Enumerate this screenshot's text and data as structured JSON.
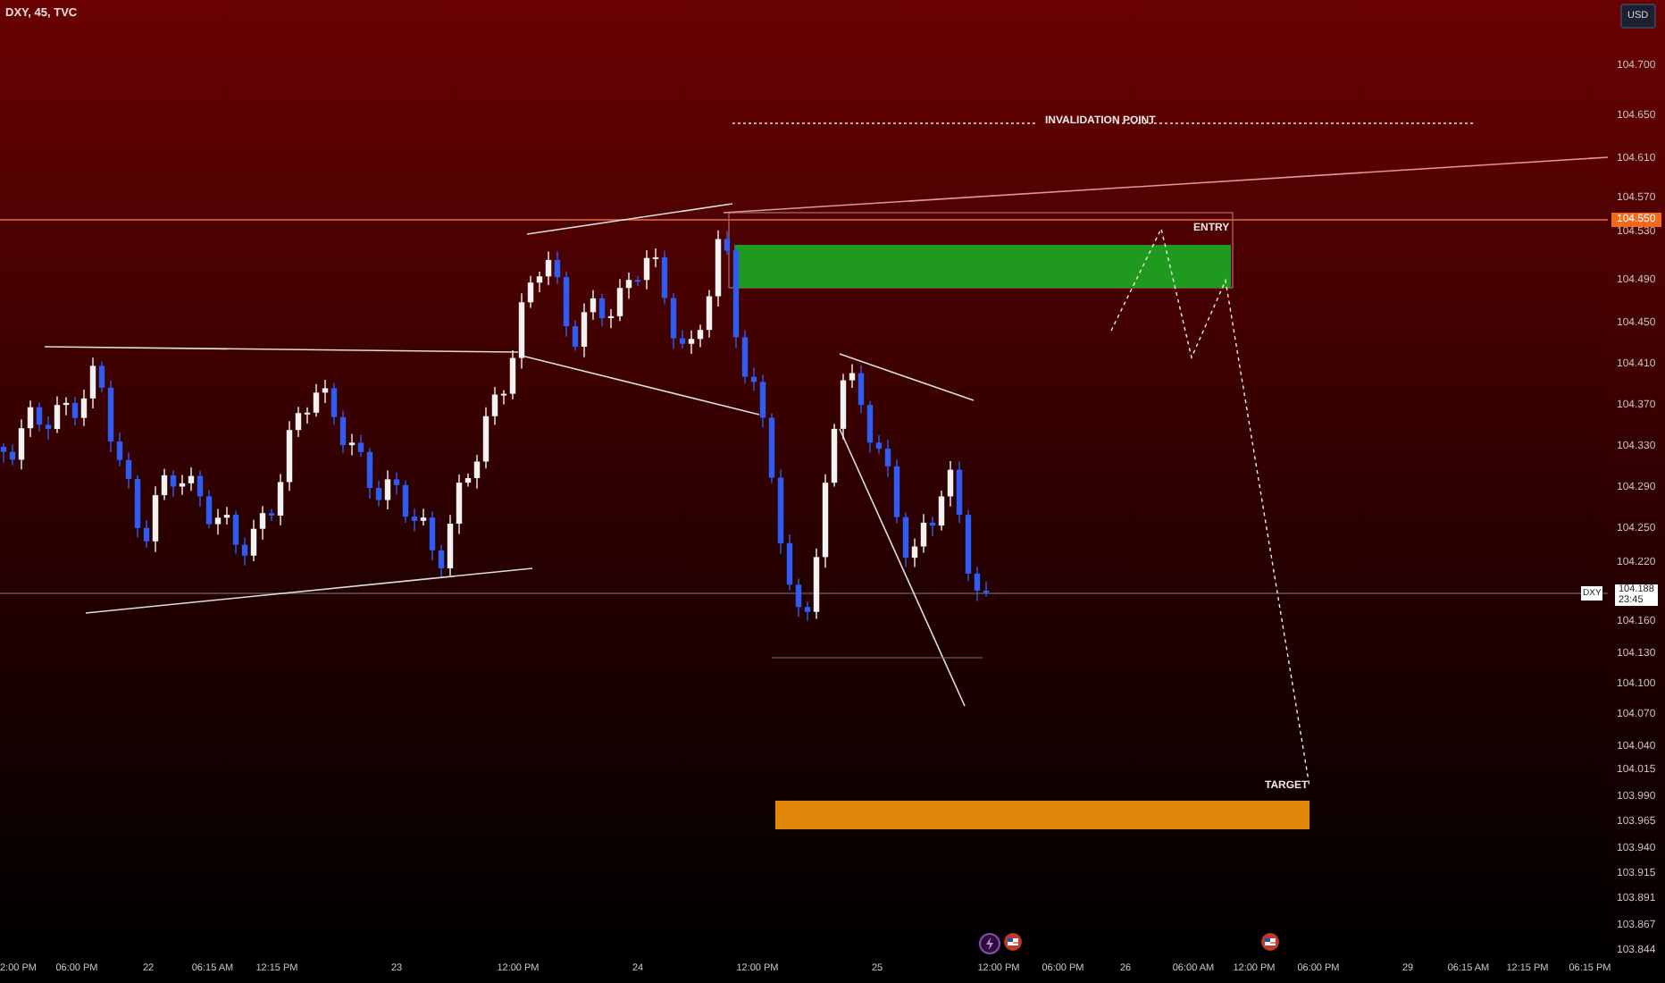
{
  "chart": {
    "symbol": "DXY, 45, TVC",
    "currency_button": "USD",
    "annotations": [
      {
        "kind": "invalidation",
        "text": "INVALIDATION POINT"
      },
      {
        "kind": "entry",
        "text": "ENTRY"
      },
      {
        "kind": "target",
        "text": "TARGET"
      }
    ]
  },
  "price_axis": {
    "labels": [
      "104.700",
      "104.650",
      "104.610",
      "104.570",
      "104.530",
      "104.490",
      "104.450",
      "104.410",
      "104.370",
      "104.330",
      "104.290",
      "104.250",
      "104.220",
      "104.160",
      "104.130",
      "104.100",
      "104.070",
      "104.040",
      "104.015",
      "103.990",
      "103.965",
      "103.940",
      "103.915",
      "103.891",
      "103.867",
      "103.844"
    ],
    "level_tag": "104.550",
    "last_price": {
      "symbol": "DXY",
      "price": "104.188",
      "countdown": "23:45"
    }
  },
  "time_axis": {
    "labels": [
      "2:00 PM",
      "06:00 PM",
      "22",
      "06:15 AM",
      "12:15 PM",
      "23",
      "12:00 PM",
      "24",
      "12:00 PM",
      "25",
      "12:00 PM",
      "06:00 PM",
      "26",
      "06:00 AM",
      "12:00 PM",
      "06:00 PM",
      "29",
      "06:15 AM",
      "12:15 PM",
      "06:15 PM"
    ]
  }
}
